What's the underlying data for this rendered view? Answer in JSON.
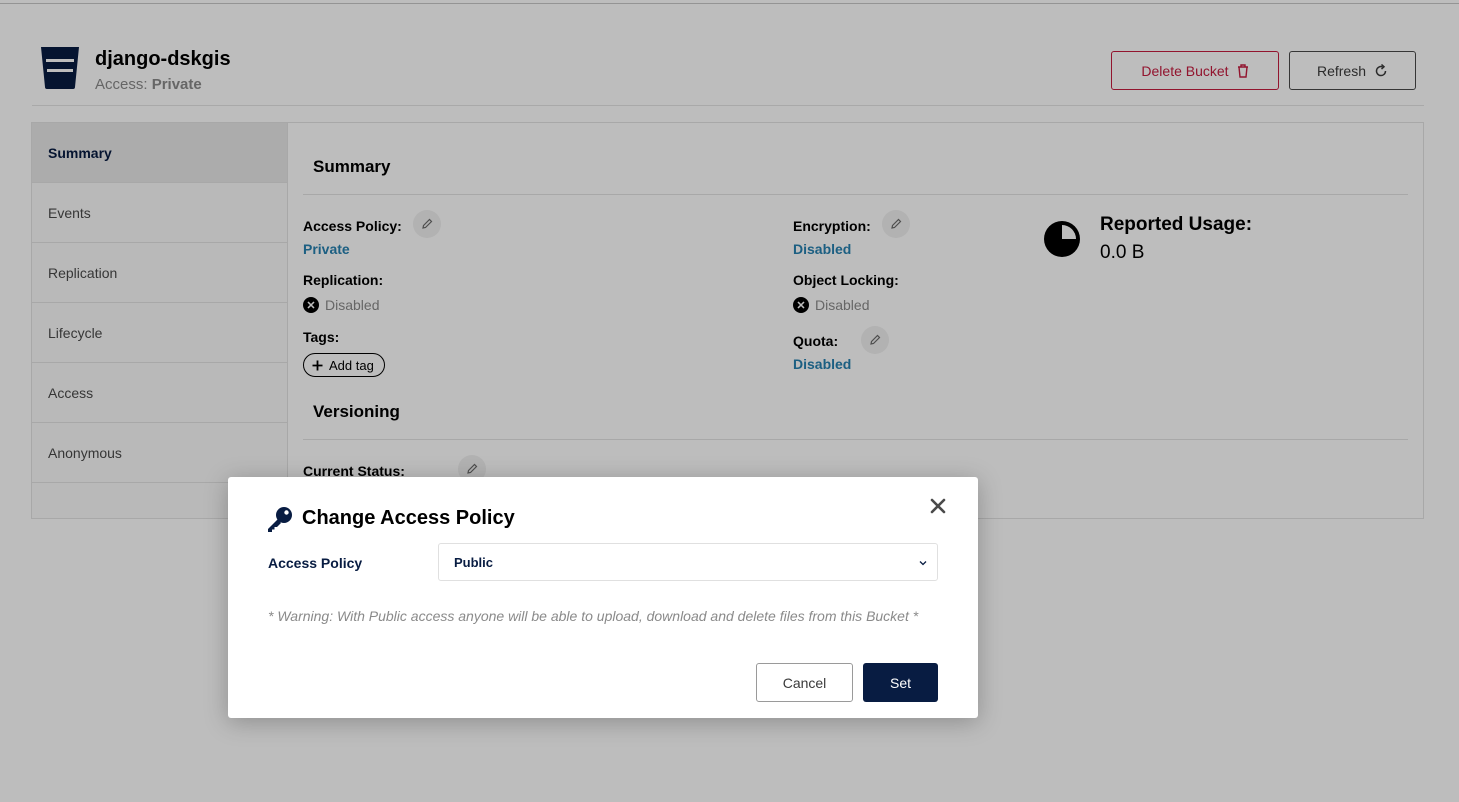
{
  "bucket": {
    "name": "django-dskgis",
    "access_label": "Access:",
    "access_value": "Private"
  },
  "actions": {
    "delete_label": "Delete Bucket",
    "refresh_label": "Refresh"
  },
  "sidebar": {
    "items": [
      {
        "label": "Summary",
        "active": true
      },
      {
        "label": "Events"
      },
      {
        "label": "Replication"
      },
      {
        "label": "Lifecycle"
      },
      {
        "label": "Access"
      },
      {
        "label": "Anonymous"
      }
    ]
  },
  "summary": {
    "title": "Summary",
    "access_policy_label": "Access Policy:",
    "access_policy_value": "Private",
    "replication_label": "Replication:",
    "replication_value": "Disabled",
    "tags_label": "Tags:",
    "add_tag_label": "Add tag",
    "encryption_label": "Encryption:",
    "encryption_value": "Disabled",
    "object_locking_label": "Object Locking:",
    "object_locking_value": "Disabled",
    "quota_label": "Quota:",
    "quota_value": "Disabled",
    "usage_label": "Reported Usage:",
    "usage_value": "0.0 B"
  },
  "versioning": {
    "title": "Versioning",
    "current_status_label": "Current Status:"
  },
  "modal": {
    "title": "Change Access Policy",
    "select_label": "Access Policy",
    "selected_value": "Public",
    "warning": "* Warning: With Public access anyone will be able to upload, download and delete files from this Bucket *",
    "cancel_label": "Cancel",
    "set_label": "Set"
  },
  "colors": {
    "brand_navy": "#081c42",
    "danger": "#c51b3f",
    "link": "#2781b0"
  },
  "icons": {
    "bucket": "bucket-icon",
    "delete": "trash-icon",
    "refresh": "refresh-icon",
    "edit": "pencil-icon",
    "disabled": "x-circle-icon",
    "add": "plus-icon",
    "usage": "pie-chart-icon",
    "modal": "key-icon",
    "close": "close-icon",
    "chevron": "chevron-down-icon"
  }
}
